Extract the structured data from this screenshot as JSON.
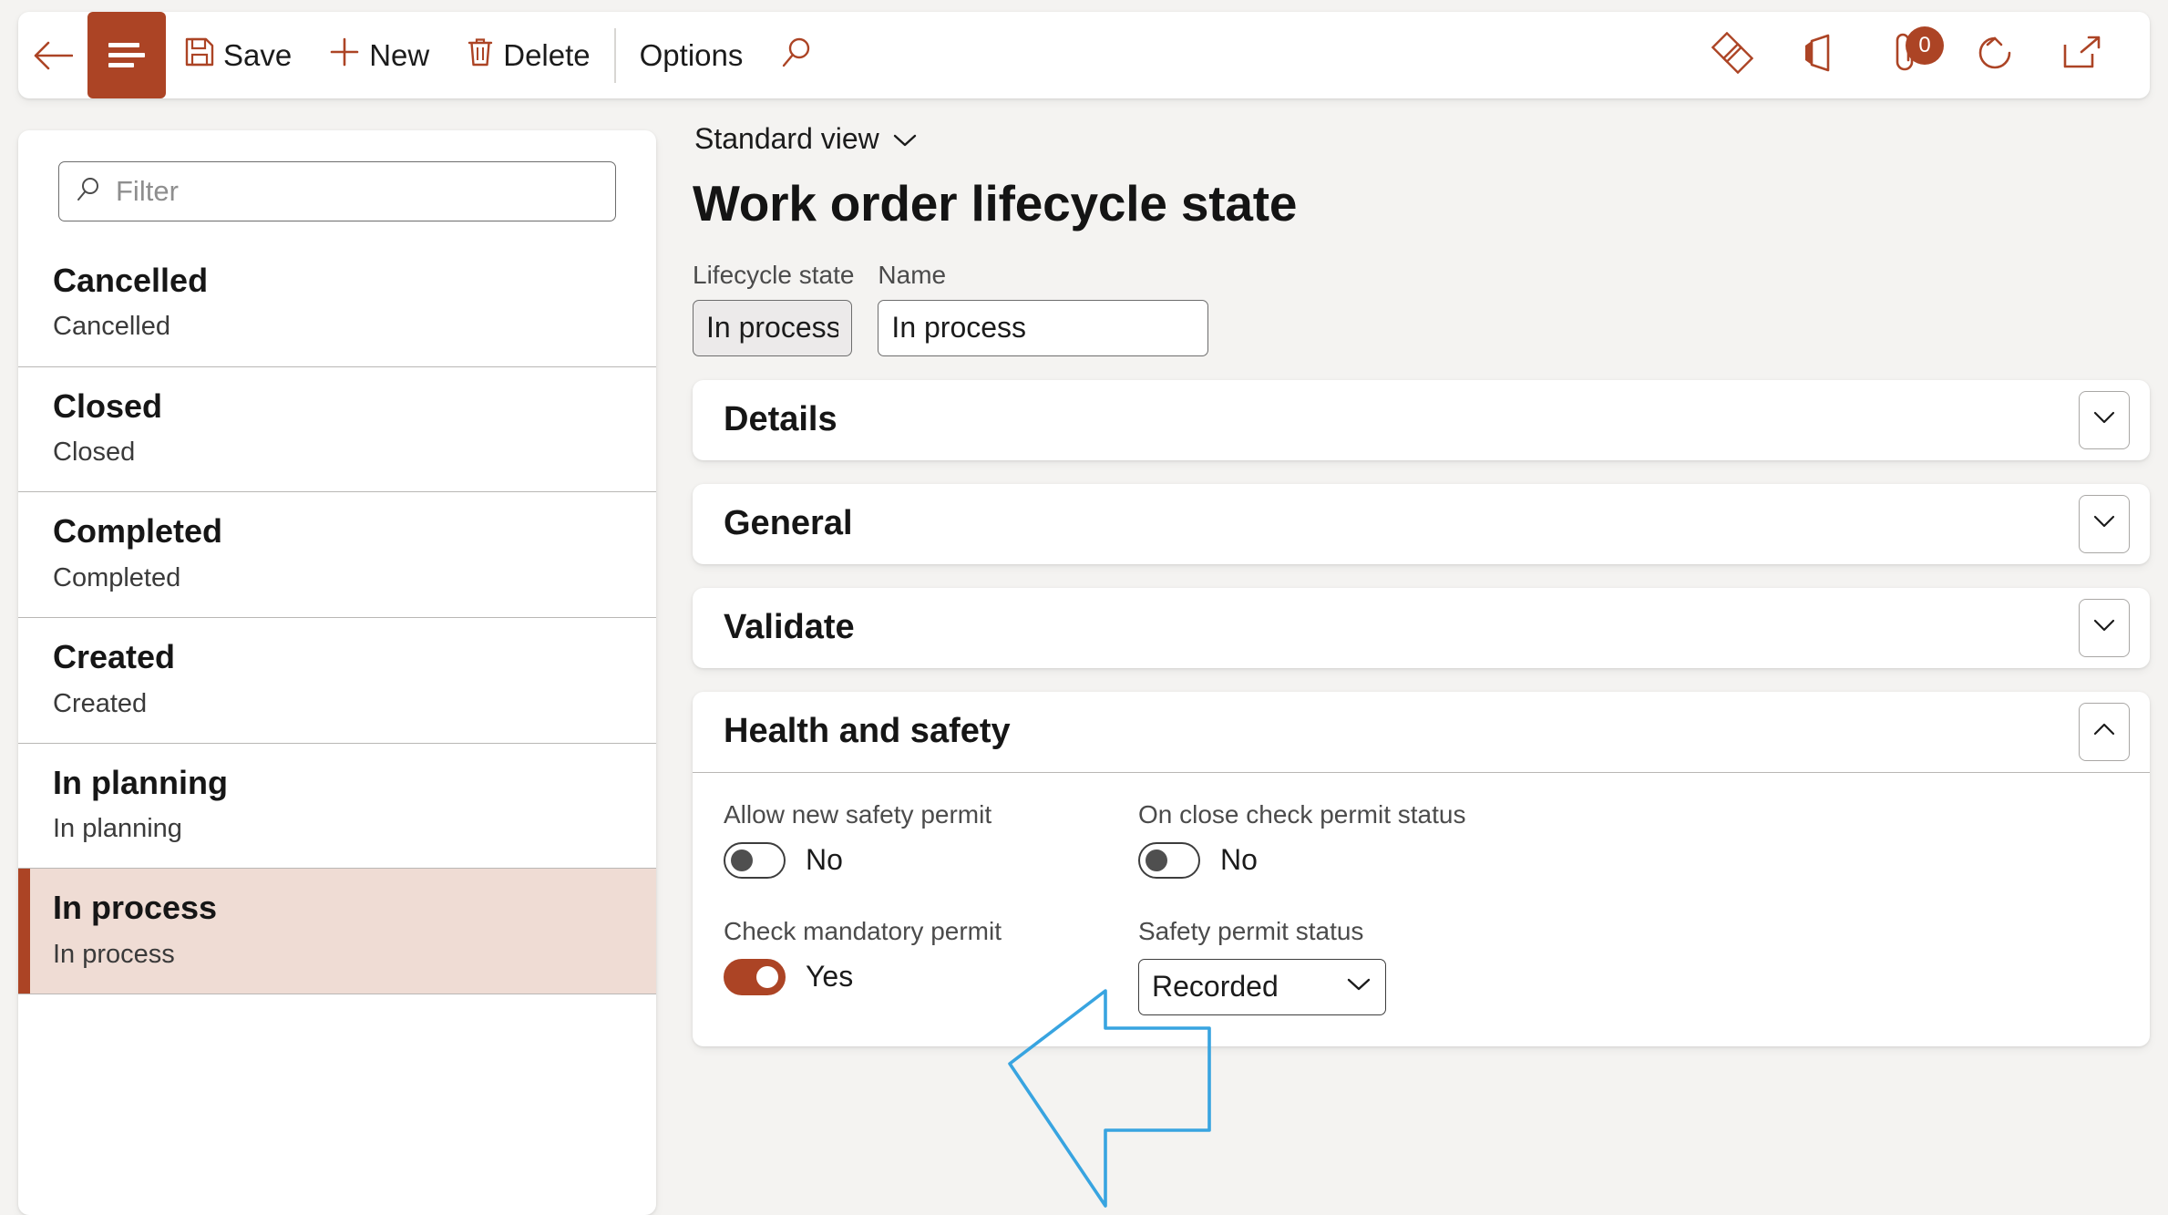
{
  "toolbar": {
    "back_icon": "back-arrow-icon",
    "menu_icon": "hamburger-menu-icon",
    "save_label": "Save",
    "save_icon": "save-floppy-icon",
    "new_label": "New",
    "new_icon": "plus-icon",
    "delete_label": "Delete",
    "delete_icon": "trash-icon",
    "options_label": "Options",
    "search_icon": "search-icon",
    "right_icons": [
      {
        "name": "dynamics-diamond-icon"
      },
      {
        "name": "office-apps-icon"
      },
      {
        "name": "attachments-paperclip-icon",
        "badge": "0"
      },
      {
        "name": "refresh-icon"
      },
      {
        "name": "open-in-new-window-icon"
      }
    ]
  },
  "sidebar": {
    "filter": {
      "placeholder": "Filter",
      "value": "",
      "icon": "search-icon"
    },
    "items": [
      {
        "title": "Cancelled",
        "subtitle": "Cancelled",
        "selected": false
      },
      {
        "title": "Closed",
        "subtitle": "Closed",
        "selected": false
      },
      {
        "title": "Completed",
        "subtitle": "Completed",
        "selected": false
      },
      {
        "title": "Created",
        "subtitle": "Created",
        "selected": false
      },
      {
        "title": "In planning",
        "subtitle": "In planning",
        "selected": false
      },
      {
        "title": "In process",
        "subtitle": "In process",
        "selected": true
      }
    ]
  },
  "main": {
    "view_selector": "Standard view",
    "page_title": "Work order lifecycle state",
    "fields": [
      {
        "label": "Lifecycle state",
        "value": "In process",
        "readonly": true
      },
      {
        "label": "Name",
        "value": "In process",
        "readonly": false
      }
    ],
    "sections": [
      {
        "title": "Details",
        "expanded": false
      },
      {
        "title": "General",
        "expanded": false
      },
      {
        "title": "Validate",
        "expanded": false
      },
      {
        "title": "Health and safety",
        "expanded": true
      }
    ],
    "health_and_safety": {
      "allow_new_safety_permit": {
        "label": "Allow new safety permit",
        "value": "No",
        "on": false
      },
      "on_close_check_permit_status": {
        "label": "On close check permit status",
        "value": "No",
        "on": false
      },
      "check_mandatory_permit": {
        "label": "Check mandatory permit",
        "value": "Yes",
        "on": true
      },
      "safety_permit_status": {
        "label": "Safety permit status",
        "value": "Recorded",
        "icon": "chevron-down-icon"
      }
    }
  },
  "annotation": {
    "arrow": "left-pointing-arrow-annotation",
    "color": "#38a4e0"
  },
  "colors": {
    "brand": "#ac4425",
    "selected_row_bg": "#efdcd4",
    "page_bg": "#f4f3f1"
  }
}
